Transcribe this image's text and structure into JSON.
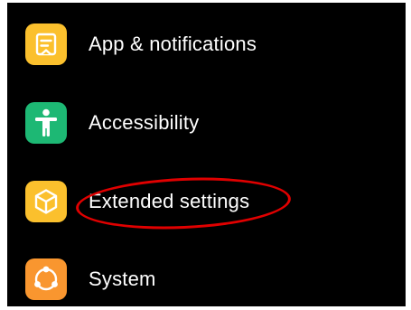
{
  "settings": {
    "items": [
      {
        "label": "App & notifications",
        "icon": "app-notifications-icon",
        "icon_color": "#FBC02D"
      },
      {
        "label": "Accessibility",
        "icon": "accessibility-icon",
        "icon_color": "#1DB874"
      },
      {
        "label": "Extended settings",
        "icon": "extended-settings-icon",
        "icon_color": "#FBC02D"
      },
      {
        "label": "System",
        "icon": "system-icon",
        "icon_color": "#F9962F"
      }
    ]
  },
  "annotation": {
    "highlight_color": "#E00000"
  }
}
